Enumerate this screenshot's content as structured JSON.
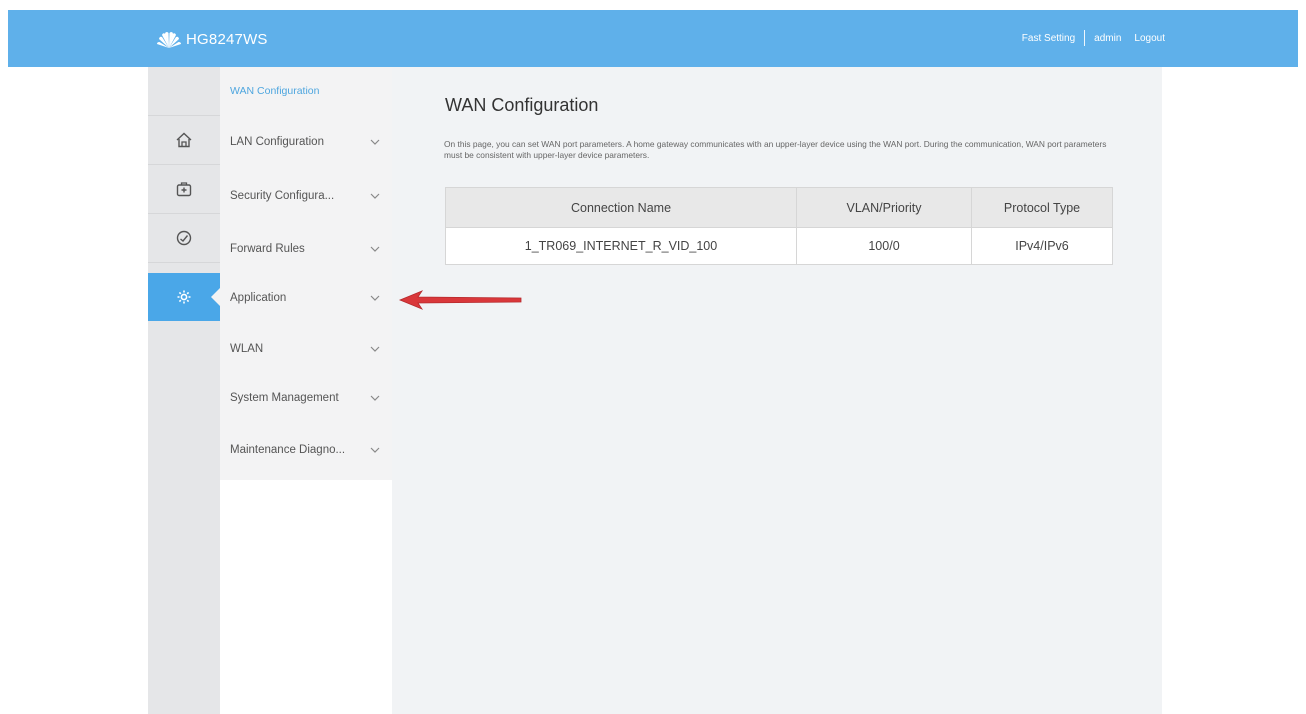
{
  "header": {
    "brand": "HG8247WS",
    "links": [
      "Fast Setting",
      "admin",
      "Logout"
    ]
  },
  "rail": {
    "icons": [
      "home-icon",
      "toolbox-icon",
      "speedometer-icon",
      "gear-icon"
    ],
    "active_index": 3
  },
  "menu": {
    "items": [
      {
        "label": "WAN Configuration",
        "expandable": false
      },
      {
        "label": "LAN Configuration",
        "expandable": true
      },
      {
        "label": "Security Configura...",
        "expandable": true
      },
      {
        "label": "Forward Rules",
        "expandable": true
      },
      {
        "label": "Application",
        "expandable": true
      },
      {
        "label": "WLAN",
        "expandable": true
      },
      {
        "label": "System Management",
        "expandable": true
      },
      {
        "label": "Maintenance Diagno...",
        "expandable": true
      }
    ]
  },
  "main": {
    "title": "WAN Configuration",
    "description": "On this page, you can set WAN port parameters. A home gateway communicates with an upper-layer device using the WAN port. During the communication, WAN port parameters must be consistent with upper-layer device parameters.",
    "table": {
      "headers": [
        "Connection Name",
        "VLAN/Priority",
        "Protocol Type"
      ],
      "rows": [
        [
          "1_TR069_INTERNET_R_VID_100",
          "100/0",
          "IPv4/IPv6"
        ]
      ]
    }
  },
  "colors": {
    "topbar": "#5fb0ea",
    "active_rail": "#4aa7e8",
    "active_menu_text": "#4ea6df",
    "annotation_arrow": "#d9373a"
  }
}
